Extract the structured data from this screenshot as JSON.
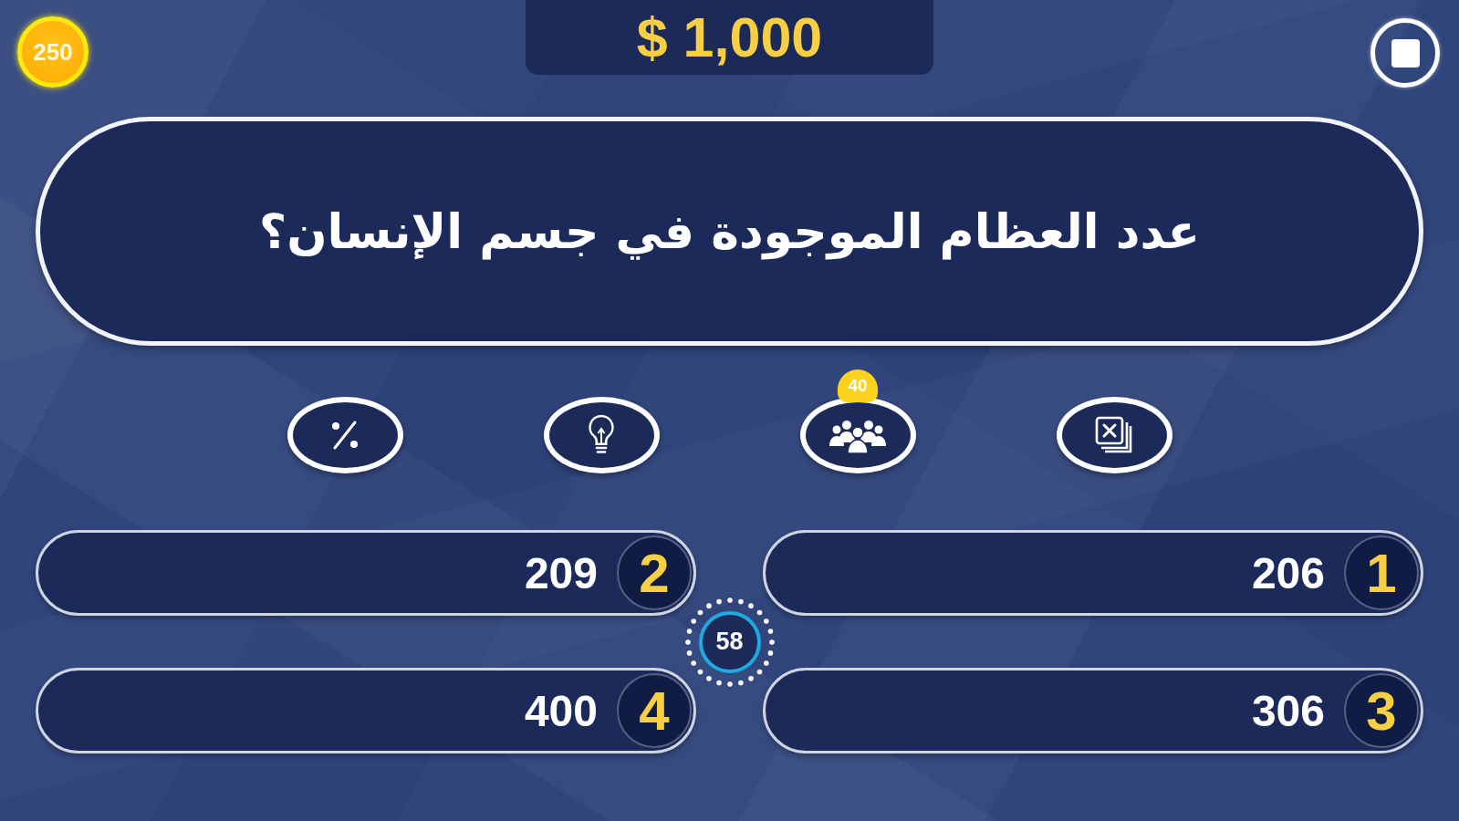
{
  "coins": "250",
  "prize": "$ 1,000",
  "question": "عدد العظام الموجودة في جسم الإنسان؟",
  "lifelines": [
    {
      "kind": "percent"
    },
    {
      "kind": "hint"
    },
    {
      "kind": "audience",
      "badge": "40"
    },
    {
      "kind": "swap"
    }
  ],
  "answers": [
    {
      "number": "2",
      "text": "209"
    },
    {
      "number": "1",
      "text": "206"
    },
    {
      "number": "4",
      "text": "400"
    },
    {
      "number": "3",
      "text": "306"
    }
  ],
  "timer": "58"
}
